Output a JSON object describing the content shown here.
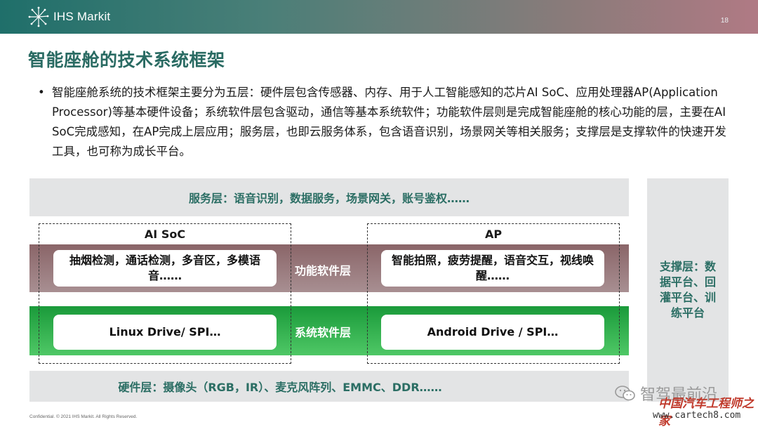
{
  "header": {
    "logo_text": "IHS Markit",
    "page_number": "18"
  },
  "title": "智能座舱的技术系统框架",
  "bullet": {
    "marker": "•",
    "text": "智能座舱系统的技术框架主要分为五层：硬件层包含传感器、内存、用于人工智能感知的芯片AI SoC、应用处理器AP(Application Processor)等基本硬件设备；系统软件层包含驱动，通信等基本系统软件；功能软件层则是完成智能座舱的核心功能的层，主要在AI SoC完成感知，在AP完成上层应用；服务层，也即云服务体系，包含语音识别，场景网关等相关服务；支撑层是支撑软件的快速开发工具，也可称为成长平台。"
  },
  "diagram": {
    "service_layer": "服务层：语音识别，数据服务，场景网关，账号鉴权……",
    "support_layer": "支撑层：数据平台、回灌平台、训练平台",
    "hardware_layer": "硬件层：摄像头（RGB，IR）、麦克风阵列、EMMC、DDR……",
    "function_layer_label": "功能软件层",
    "system_layer_label": "系统软件层",
    "ai_soc": {
      "title": "AI SoC",
      "function": "抽烟检测，通话检测，多音区，多模语音……",
      "system": "Linux Drive/ SPI…"
    },
    "ap": {
      "title": "AP",
      "function": "智能拍照，疲劳提醒，语音交互，视线唤醒……",
      "system": "Android Drive / SPI…"
    }
  },
  "footer": "Confidential. © 2021 IHS Markit. All Rights Reserved.",
  "watermark": {
    "line1": "智驾最前沿",
    "line2": "中国汽车工程师之家",
    "line3": "www.cartech8.com"
  },
  "colors": {
    "title": "#2a6b63",
    "function_band": "#8a6568",
    "system_band": "#1a9a3a",
    "layer_gray": "#e3e4e5"
  }
}
